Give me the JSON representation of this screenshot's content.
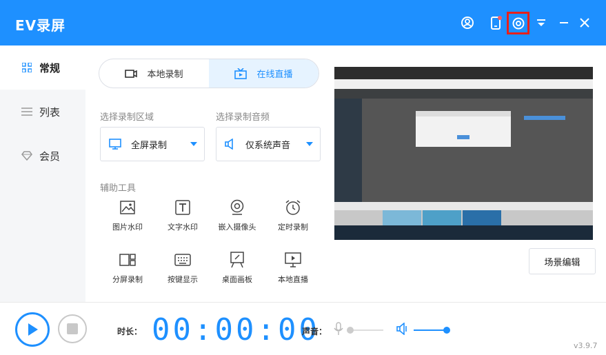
{
  "app": {
    "title": "EV录屏"
  },
  "titlebar_icons": {
    "account": "user-circle-icon",
    "phone": "mobile-icon",
    "settings": "gear-icon",
    "menu": "dropdown-menu-icon",
    "minimize": "minimize-icon",
    "close": "close-icon",
    "settings_highlight_color": "#e8201a"
  },
  "sidebar": {
    "items": [
      {
        "label": "常规",
        "icon": "grid-icon",
        "active": true
      },
      {
        "label": "列表",
        "icon": "list-icon",
        "active": false
      },
      {
        "label": "会员",
        "icon": "diamond-icon",
        "active": false
      }
    ]
  },
  "mode_tabs": [
    {
      "label": "本地录制",
      "icon": "video-icon",
      "active": false
    },
    {
      "label": "在线直播",
      "icon": "tv-icon",
      "active": true
    }
  ],
  "record_area": {
    "label": "选择录制区域",
    "value": "全屏录制",
    "icon": "monitor-icon"
  },
  "record_audio": {
    "label": "选择录制音频",
    "value": "仅系统声音",
    "icon": "speaker-icon"
  },
  "tools": {
    "label": "辅助工具",
    "items": [
      {
        "label": "图片水印",
        "icon": "image-icon"
      },
      {
        "label": "文字水印",
        "icon": "text-icon"
      },
      {
        "label": "嵌入摄像头",
        "icon": "webcam-icon"
      },
      {
        "label": "定时录制",
        "icon": "alarm-icon"
      },
      {
        "label": "分屏录制",
        "icon": "split-screen-icon"
      },
      {
        "label": "按键显示",
        "icon": "keyboard-icon"
      },
      {
        "label": "桌面画板",
        "icon": "easel-icon"
      },
      {
        "label": "本地直播",
        "icon": "broadcast-icon"
      }
    ]
  },
  "scene_edit_label": "场景编辑",
  "bottom": {
    "duration_label": "时长：",
    "timer": "00:00:00",
    "volume_label": "声音：",
    "mic_level": 0.0,
    "system_level": 1.0,
    "version": "v3.9.7"
  },
  "colors": {
    "accent": "#1e90ff",
    "titlebar": "#1e90ff",
    "active_tab_bg": "#e6f3ff"
  }
}
